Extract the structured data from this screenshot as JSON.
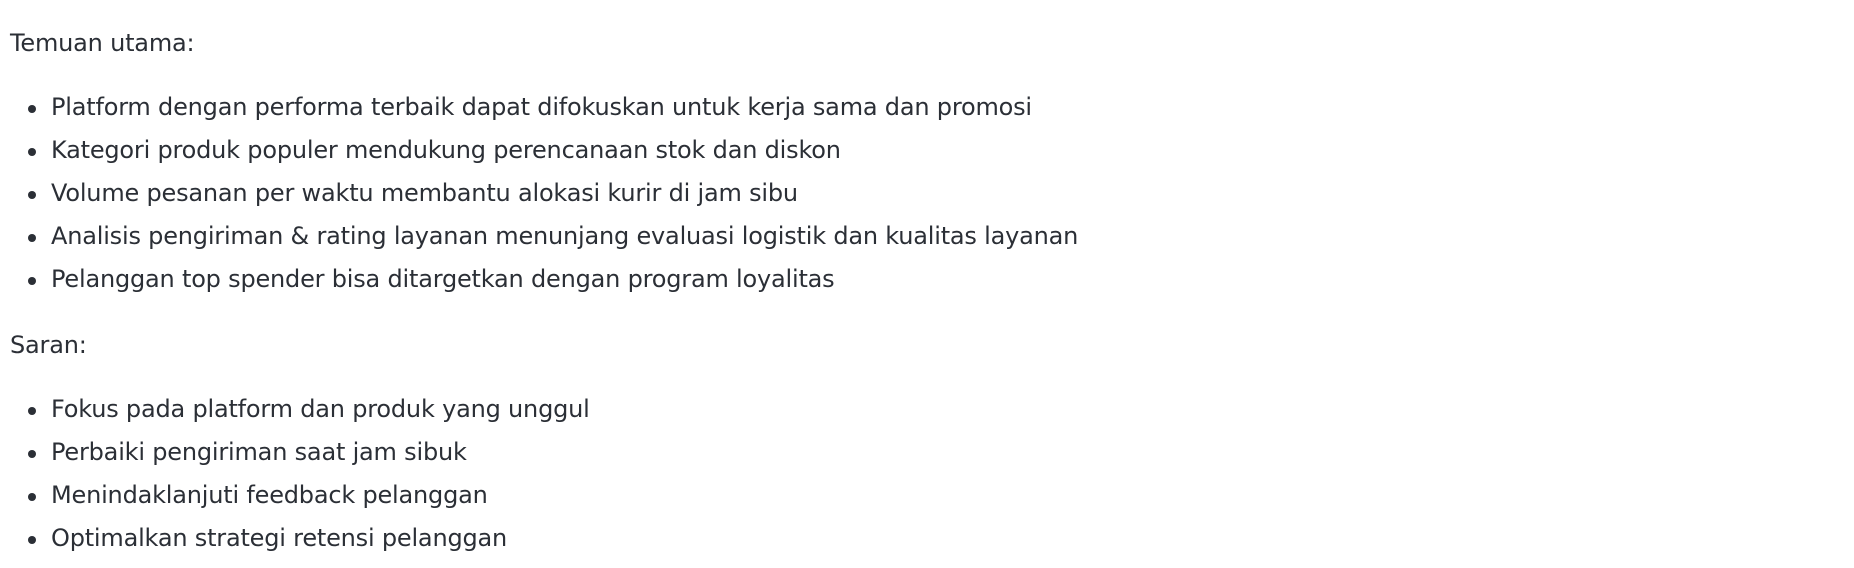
{
  "findings": {
    "heading": "Temuan utama:",
    "items": [
      "Platform dengan performa terbaik dapat difokuskan untuk kerja sama dan promosi",
      "Kategori produk populer mendukung perencanaan stok dan diskon",
      "Volume pesanan per waktu membantu alokasi kurir di jam sibu",
      "Analisis pengiriman & rating layanan menunjang evaluasi logistik dan kualitas layanan",
      "Pelanggan top spender bisa ditargetkan dengan program loyalitas"
    ]
  },
  "suggestions": {
    "heading": "Saran:",
    "items": [
      "Fokus pada platform dan produk yang unggul",
      "Perbaiki pengiriman saat jam sibuk",
      "Menindaklanjuti feedback pelanggan",
      "Optimalkan strategi retensi pelanggan"
    ]
  }
}
